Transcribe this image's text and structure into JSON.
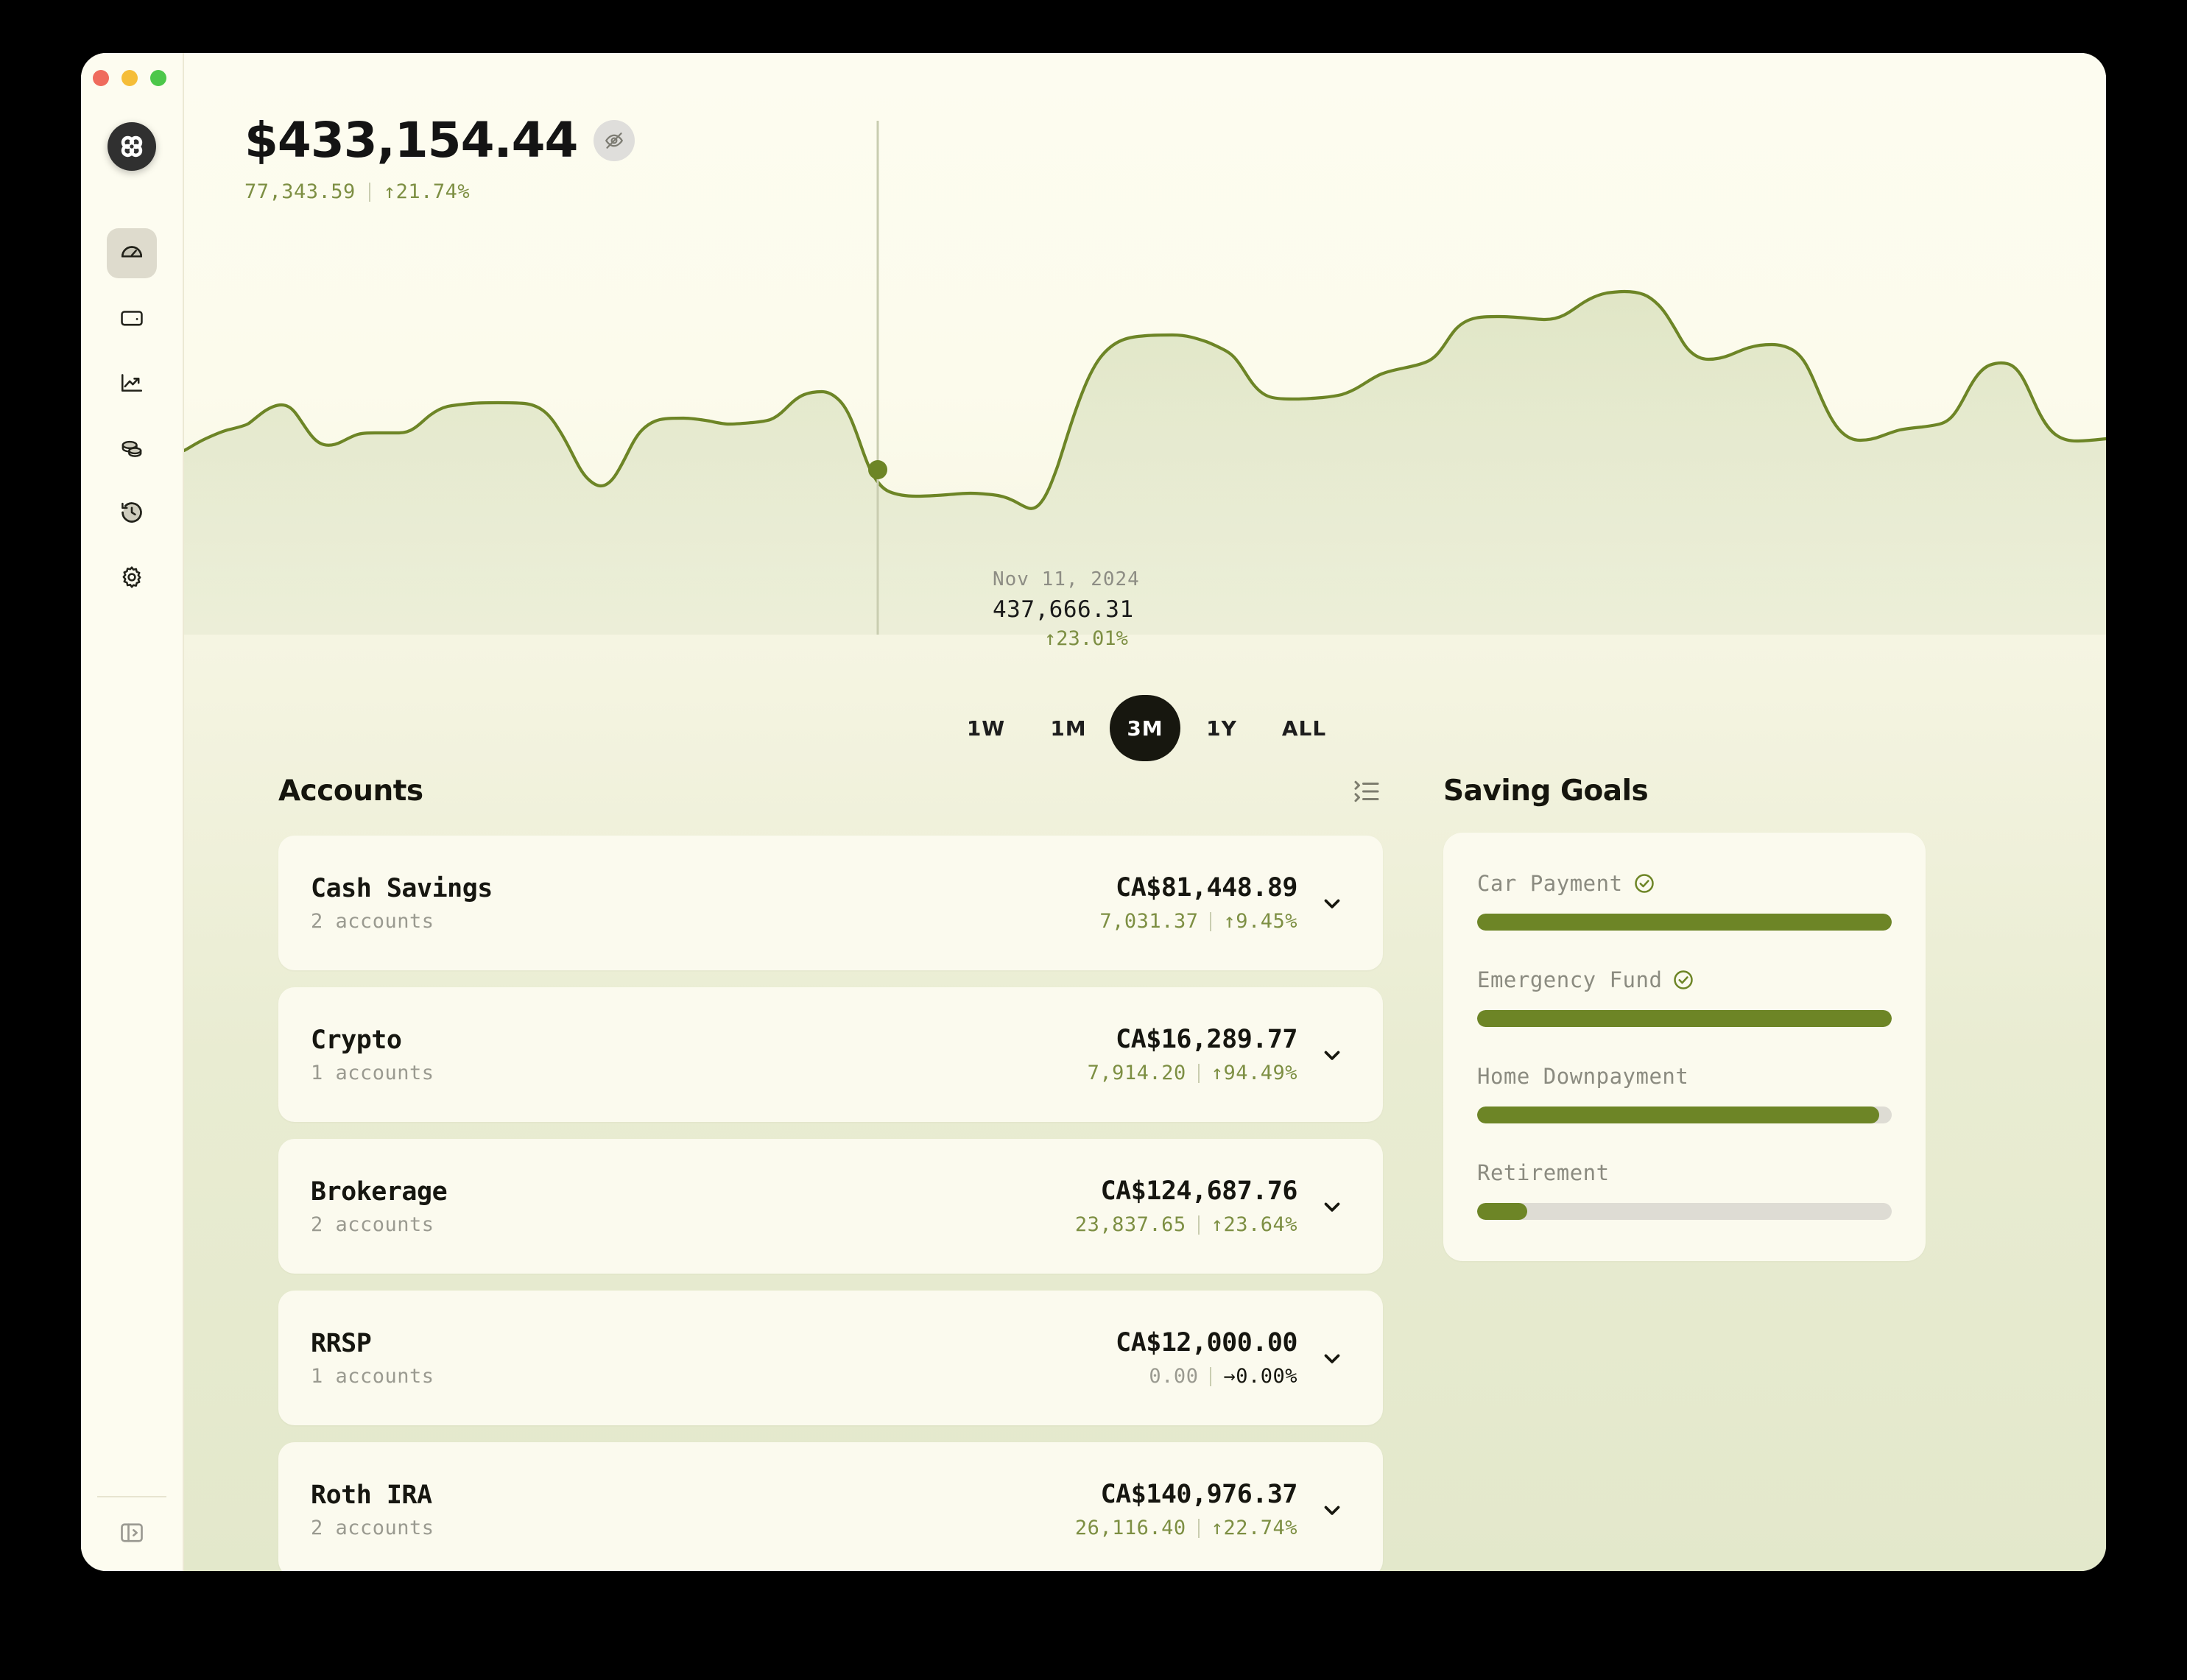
{
  "window": {
    "traffic_lights": [
      "close",
      "minimize",
      "maximize"
    ]
  },
  "sidebar": {
    "brand": {
      "name": "app-logo",
      "icon": "clover-circles-icon"
    },
    "items": [
      {
        "name": "dashboard",
        "icon": "gauge-icon",
        "active": true
      },
      {
        "name": "accounts",
        "icon": "wallet-icon",
        "active": false
      },
      {
        "name": "investments",
        "icon": "trending-up-icon",
        "active": false
      },
      {
        "name": "assets",
        "icon": "coins-icon",
        "active": false
      },
      {
        "name": "history",
        "icon": "history-clock-icon",
        "active": false
      },
      {
        "name": "settings",
        "icon": "gear-icon",
        "active": false
      }
    ],
    "footer": {
      "toggle_icon": "panel-expand-icon"
    }
  },
  "header": {
    "total_balance": "$433,154.44",
    "visibility_icon": "eye-off-icon",
    "change_amount": "77,343.59",
    "change_pct": "↑21.74%",
    "accent_green": "#7d8f43"
  },
  "tooltip": {
    "date": "Nov 11, 2024",
    "value": "437,666.31",
    "change_pct": "↑23.01%"
  },
  "range_selector": {
    "options": [
      {
        "label": "1W",
        "active": false
      },
      {
        "label": "1M",
        "active": false
      },
      {
        "label": "3M",
        "active": true
      },
      {
        "label": "1Y",
        "active": false
      },
      {
        "label": "ALL",
        "active": false
      }
    ]
  },
  "chart_data": {
    "type": "area",
    "title": "",
    "xlabel": "",
    "ylabel": "",
    "line_color": "#6d8526",
    "fill_color": "#e3e8cb",
    "grid": false,
    "legend": false,
    "hover_point": {
      "x_label": "Nov 11, 2024",
      "y": 437666.31,
      "change_pct": 23.01
    },
    "selected_range": "3M",
    "ylim": [
      330000,
      460000
    ],
    "x": [
      0,
      1,
      2,
      3,
      4,
      5,
      6,
      7,
      8,
      9,
      10,
      11,
      12,
      13,
      14,
      15,
      16,
      17,
      18,
      19,
      20,
      21,
      22,
      23,
      24,
      25,
      26,
      27,
      28,
      29,
      30,
      31,
      32,
      33,
      34,
      35,
      36,
      37,
      38,
      39,
      40,
      41,
      42,
      43,
      44,
      45,
      46,
      47,
      48,
      49,
      50,
      51,
      52,
      53,
      54,
      55,
      56,
      57,
      58,
      59,
      60,
      61,
      62,
      63,
      64,
      65,
      66,
      67,
      68,
      69,
      70,
      71,
      72,
      73,
      74,
      75,
      76,
      77,
      78,
      79,
      80,
      81,
      82,
      83,
      84,
      85,
      86,
      87,
      88
    ],
    "values": [
      356000,
      358500,
      362000,
      364500,
      360500,
      355500,
      358500,
      359000,
      359000,
      359500,
      361500,
      364500,
      365500,
      365800,
      365900,
      365800,
      364500,
      362000,
      357500,
      352500,
      350000,
      351500,
      355500,
      358500,
      360500,
      361000,
      361000,
      362000,
      364500,
      367000,
      368000,
      365500,
      358500,
      351500,
      349500,
      350000,
      350500,
      350000,
      349000,
      352500,
      364500,
      384000,
      398500,
      404500,
      406500,
      408000,
      409500,
      409000,
      407500,
      406500,
      405000,
      401500,
      396500,
      393500,
      393000,
      393500,
      394000,
      396500,
      403500,
      411000,
      415000,
      415500,
      416000,
      416500,
      419500,
      424500,
      426500,
      424500,
      425500,
      430500,
      434000,
      432000,
      431500,
      433500,
      437500,
      434500,
      432000,
      430500,
      428500,
      427500,
      430500,
      433000,
      432500,
      428500,
      424500,
      418500,
      421500,
      420000,
      416000
    ]
  },
  "accounts_section": {
    "title": "Accounts",
    "list_icon": "list-collapse-icon",
    "accounts": [
      {
        "name": "Cash Savings",
        "subtitle": "2 accounts",
        "balance": "CA$81,448.89",
        "delta_amount": "7,031.37",
        "delta_pct": "↑9.45%",
        "trend": "up",
        "chevron": "chevron-down-icon"
      },
      {
        "name": "Crypto",
        "subtitle": "1 accounts",
        "balance": "CA$16,289.77",
        "delta_amount": "7,914.20",
        "delta_pct": "↑94.49%",
        "trend": "up",
        "chevron": "chevron-down-icon"
      },
      {
        "name": "Brokerage",
        "subtitle": "2 accounts",
        "balance": "CA$124,687.76",
        "delta_amount": "23,837.65",
        "delta_pct": "↑23.64%",
        "trend": "up",
        "chevron": "chevron-down-icon"
      },
      {
        "name": "RRSP",
        "subtitle": "1 accounts",
        "balance": "CA$12,000.00",
        "delta_amount": "0.00",
        "delta_pct": "→0.00%",
        "trend": "flat",
        "chevron": "chevron-down-icon"
      },
      {
        "name": "Roth IRA",
        "subtitle": "2 accounts",
        "balance": "CA$140,976.37",
        "delta_amount": "26,116.40",
        "delta_pct": "↑22.74%",
        "trend": "up",
        "chevron": "chevron-down-icon"
      }
    ]
  },
  "saving_goals": {
    "title": "Saving Goals",
    "bar_color": "#6d8526",
    "track_color": "#dedcd4",
    "goals": [
      {
        "label": "Car Payment",
        "percent": 100,
        "complete": true,
        "check_icon": "check-circle-icon"
      },
      {
        "label": "Emergency Fund",
        "percent": 100,
        "complete": true,
        "check_icon": "check-circle-icon"
      },
      {
        "label": "Home Downpayment",
        "percent": 97,
        "complete": false,
        "check_icon": ""
      },
      {
        "label": "Retirement",
        "percent": 12,
        "complete": false,
        "check_icon": ""
      }
    ]
  }
}
